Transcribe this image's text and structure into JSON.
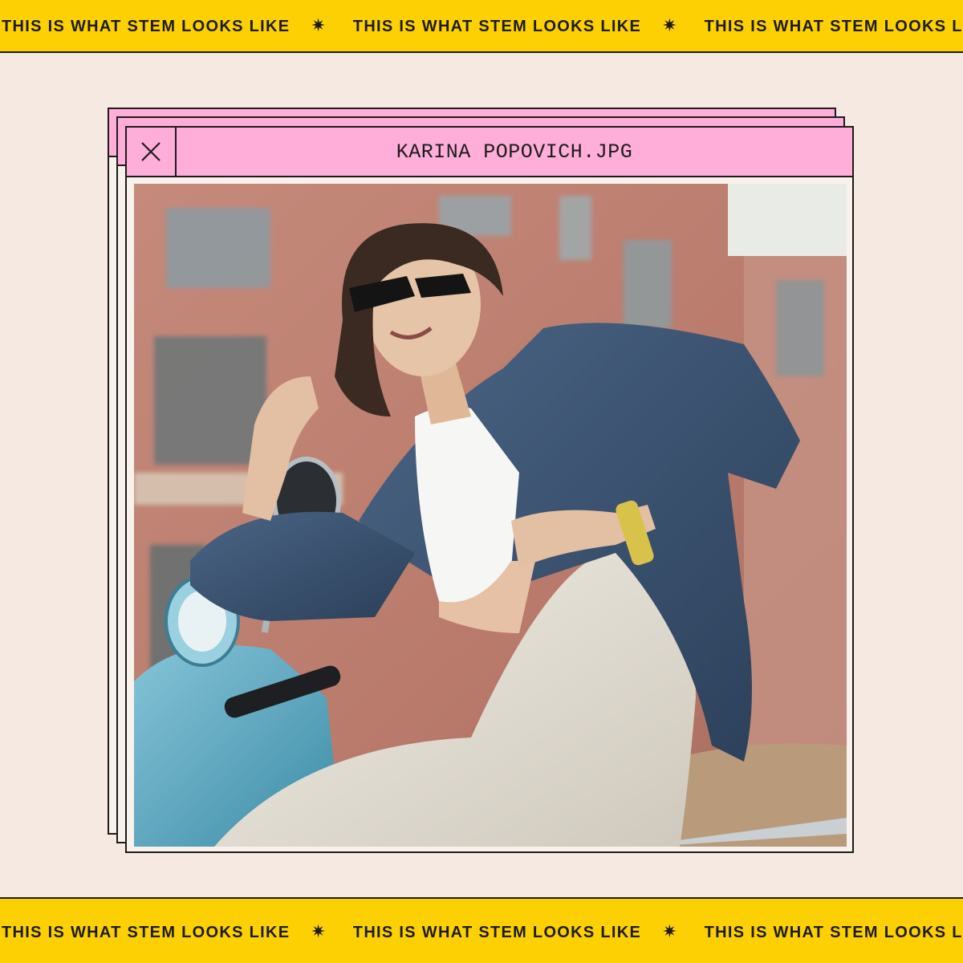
{
  "banner": {
    "text": "THIS IS WHAT STEM LOOKS LIKE",
    "separator": "✷"
  },
  "window": {
    "title": "KARINA POPOVICH.JPG",
    "close_icon": "close-icon"
  },
  "photo": {
    "description_icon": "photo-image"
  },
  "colors": {
    "banner_yellow": "#fdd004",
    "titlebar_pink": "#ffadd9",
    "background": "#f5e9e2",
    "ink": "#1c1c1c"
  }
}
